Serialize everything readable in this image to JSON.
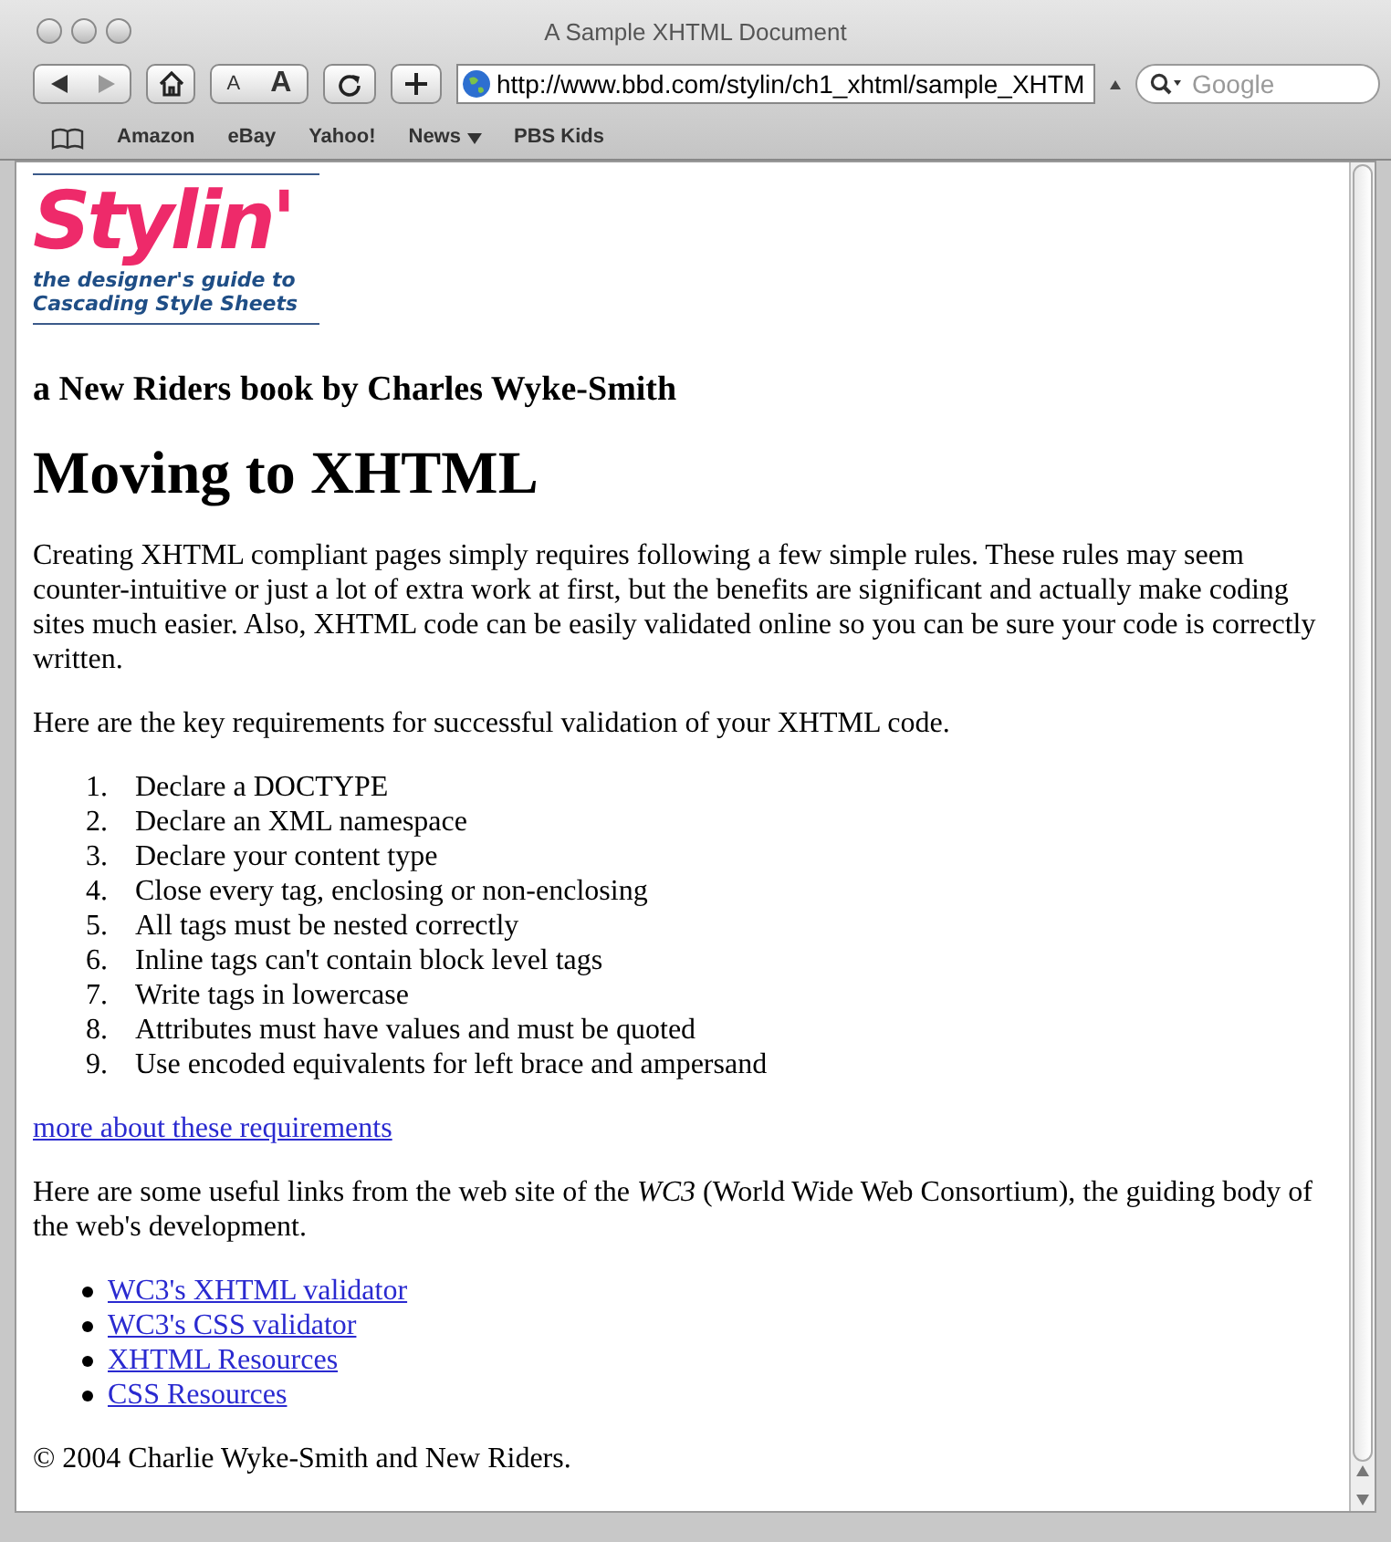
{
  "window": {
    "title": "A Sample XHTML Document"
  },
  "toolbar": {
    "text_smaller": "A",
    "text_bigger": "A",
    "address": "http://www.bbd.com/stylin/ch1_xhtml/sample_XHTM",
    "search": {
      "placeholder": "Google"
    }
  },
  "bookmarks": [
    {
      "label": "Amazon",
      "menu": false
    },
    {
      "label": "eBay",
      "menu": false
    },
    {
      "label": "Yahoo!",
      "menu": false
    },
    {
      "label": "News",
      "menu": true
    },
    {
      "label": "PBS Kids",
      "menu": false
    }
  ],
  "page": {
    "logo": {
      "title": "Stylin'",
      "tagline_1": "the designer's guide to",
      "tagline_2": "Cascading Style Sheets"
    },
    "subtitle": "a New Riders book by Charles Wyke-Smith",
    "heading": "Moving to XHTML",
    "intro": "Creating XHTML compliant pages simply requires following a few simple rules. These rules may seem counter-intuitive or just a lot of extra work at first, but the benefits are significant and actually make coding sites much easier. Also, XHTML code can be easily validated online so you can be sure your code is correctly written.",
    "requirements_intro": "Here are the key requirements for successful validation of your XHTML code.",
    "requirements": [
      {
        "number": "1.",
        "text": "Declare a DOCTYPE"
      },
      {
        "number": "2.",
        "text": "Declare an XML namespace"
      },
      {
        "number": "3.",
        "text": "Declare your content type"
      },
      {
        "number": "4.",
        "text": "Close every tag, enclosing or non-enclosing"
      },
      {
        "number": "5.",
        "text": "All tags must be nested correctly"
      },
      {
        "number": "6.",
        "text": "Inline tags can't contain block level tags"
      },
      {
        "number": "7.",
        "text": "Write tags in lowercase"
      },
      {
        "number": "8.",
        "text": "Attributes must have values and must be quoted"
      },
      {
        "number": "9.",
        "text": "Use encoded equivalents for left brace and ampersand"
      }
    ],
    "more_link": "more about these requirements",
    "links_intro": "Here are some useful links from the web site of the *WC3* (World Wide Web Consortium), the guiding body of the web's development.",
    "links": [
      "WC3's XHTML validator",
      "WC3's CSS validator",
      "XHTML Resources",
      "CSS Resources"
    ],
    "footer": "© 2004 Charlie Wyke-Smith and New Riders."
  }
}
